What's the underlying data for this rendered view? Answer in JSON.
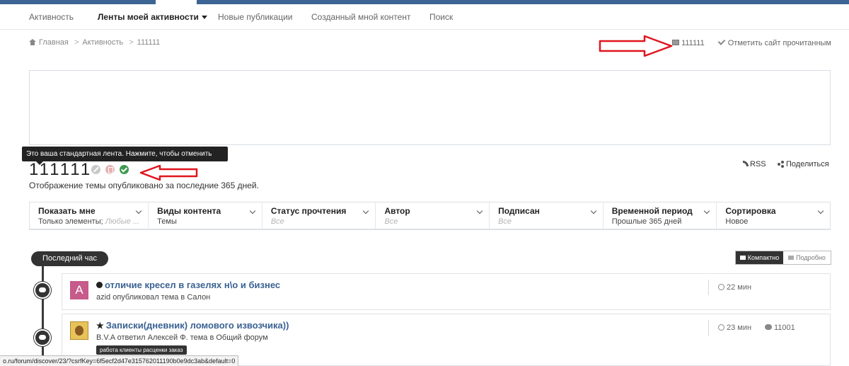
{
  "nav": {
    "items": [
      {
        "label": "Активность"
      },
      {
        "label": "Ленты моей активности"
      },
      {
        "label": "Новые публикации"
      },
      {
        "label": "Созданный мной контент"
      },
      {
        "label": "Поиск"
      }
    ]
  },
  "breadcrumb": [
    "Главная",
    "Активность",
    "111111"
  ],
  "top_right": {
    "feed_label": "111111",
    "mark_read_label": "Отметить сайт прочитанным"
  },
  "tooltip": "Это ваша стандартная лента. Нажмите, чтобы отменить",
  "stream": {
    "title": "111111",
    "description": "Отображение темы опубликовано за последние 365 дней.",
    "rss_label": "RSS",
    "share_label": "Поделиться"
  },
  "filters": [
    {
      "title": "Показать мне",
      "value": "Только элементы;",
      "value_muted": "Любые ..."
    },
    {
      "title": "Виды контента",
      "value": "Темы"
    },
    {
      "title": "Статус прочтения",
      "value_muted": "Все"
    },
    {
      "title": "Автор",
      "value_muted": "Все"
    },
    {
      "title": "Подписан",
      "value_muted": "Все"
    },
    {
      "title": "Временной период",
      "value": "Прошлые 365 дней"
    },
    {
      "title": "Сортировка",
      "value": "Новое"
    }
  ],
  "timeline": {
    "period_label": "Последний час",
    "view_compact": "Компактно",
    "view_detailed": "Подробно"
  },
  "entries": [
    {
      "avatar_letter": "A",
      "title": "отличие кресел в газелях н\\о и бизнес",
      "meta": "azid опубликовал тема в Салон",
      "time": "22 мин"
    },
    {
      "title": "Записки(дневник) ломового извозчика))",
      "meta": "B.V.A ответил Алексей Ф. тема в Общий форум",
      "time": "23 мин",
      "comments": "11001",
      "tag": "работа клиенты расценки заказ"
    }
  ],
  "status_url": "o.ru/forum/discover/23/?csrfKey=6f5ecf2d47e315762011190b0e9dc3ab&default=0",
  "colors": {
    "accent": "#3d6594",
    "link": "#3a6293",
    "arrow": "#e0141e",
    "dark": "#333333"
  }
}
